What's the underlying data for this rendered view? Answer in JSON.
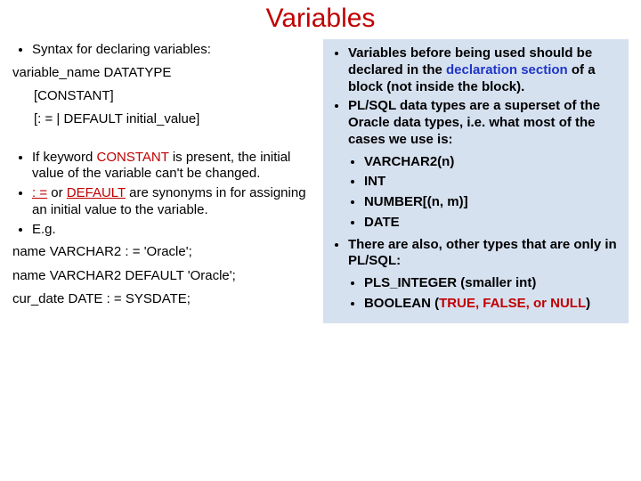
{
  "title": "Variables",
  "left": {
    "b1": "Syntax for declaring variables:",
    "syntax1": "variable_name DATATYPE",
    "syntax2": "[CONSTANT]",
    "syntax3": "[: = | DEFAULT initial_value]",
    "b2_pre": "If keyword ",
    "b2_kw": "CONSTANT",
    "b2_post": " is present, the initial value of the variable can't be changed.",
    "b3_kw1": ": =",
    "b3_mid": " or ",
    "b3_kw2": "DEFAULT",
    "b3_post": " are synonyms in for assigning an initial value to the variable.",
    "b4": "E.g.",
    "ex1": "name VARCHAR2 : = 'Oracle';",
    "ex2": "name VARCHAR2 DEFAULT 'Oracle';",
    "ex3": "cur_date DATE : = SYSDATE;"
  },
  "right": {
    "b1_pre": "Variables before being used should be declared in the ",
    "b1_em": "declaration section",
    "b1_post": " of a block (not inside the block).",
    "b2": "PL/SQL data types are a superset of the Oracle data types, i.e. what most of the cases we use is:",
    "types1": [
      "VARCHAR2(n)",
      "INT",
      "NUMBER[(n, m)]",
      "DATE"
    ],
    "b3": "There are also, other types that are only in PL/SQL:",
    "types2_a": "PLS_INTEGER (smaller int)",
    "types2_b_pre": "BOOLEAN (",
    "types2_b_vals": "TRUE, FALSE, or NULL",
    "types2_b_post": ")"
  }
}
